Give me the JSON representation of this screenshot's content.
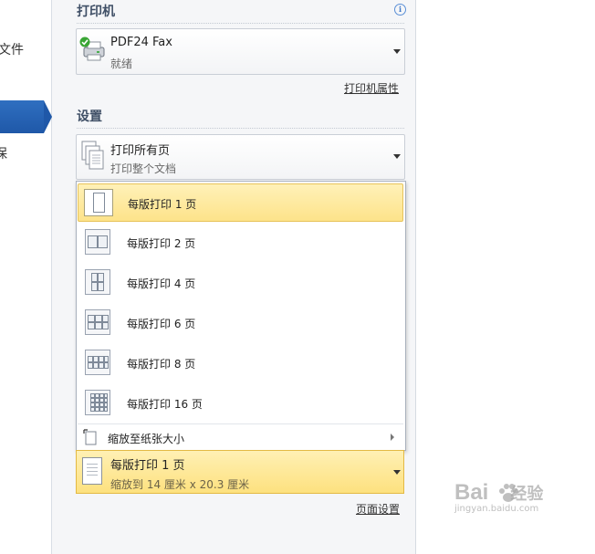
{
  "nav": {
    "file_label": "文件",
    "save_label": "保"
  },
  "printer": {
    "section_title": "打印机",
    "name": "PDF24 Fax",
    "status": "就绪",
    "properties_link": "打印机属性"
  },
  "settings": {
    "section_title": "设置",
    "range_main": "打印所有页",
    "range_sub": "打印整个文档",
    "pages_per_sheet_options": [
      {
        "label": "每版打印 1 页",
        "selected": true
      },
      {
        "label": "每版打印 2 页",
        "selected": false
      },
      {
        "label": "每版打印 4 页",
        "selected": false
      },
      {
        "label": "每版打印 6 页",
        "selected": false
      },
      {
        "label": "每版打印 8 页",
        "selected": false
      },
      {
        "label": "每版打印 16 页",
        "selected": false
      }
    ],
    "scale_to_paper_label": "缩放至纸张大小",
    "current_main": "每版打印 1 页",
    "current_sub": "缩放到 14 厘米 x 20.3 厘米",
    "page_setup_link": "页面设置"
  },
  "watermark": {
    "brand": "Bai",
    "brand_cn": "经验",
    "url": "jingyan.baidu.com"
  },
  "colors": {
    "nav_selected": "#1f58a8",
    "highlight": "#fde38a",
    "panel_bg": "#f5f6f8"
  }
}
